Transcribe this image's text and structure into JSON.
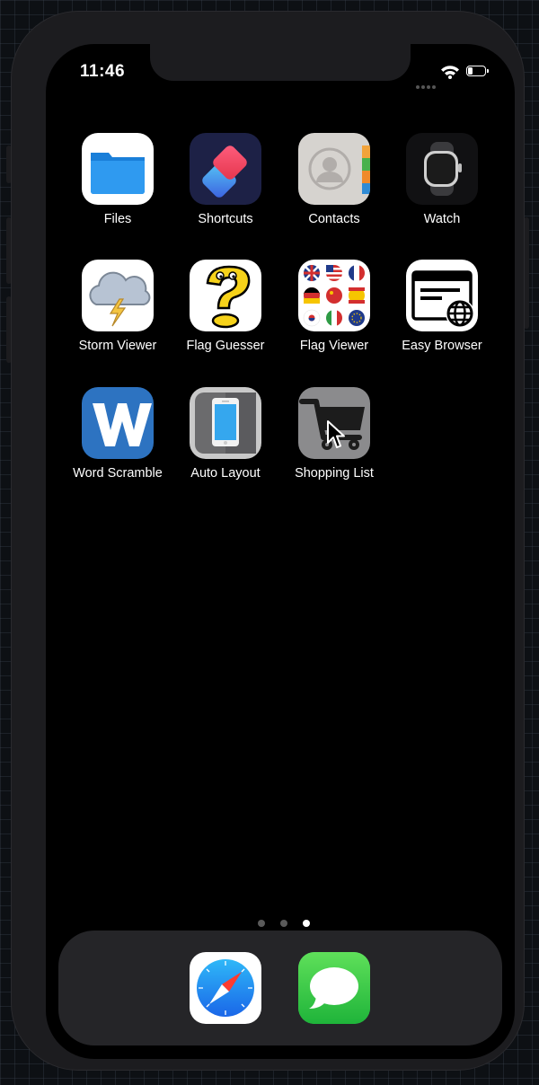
{
  "status_bar": {
    "time": "11:46",
    "battery_level": 0.3,
    "wifi_icon": "wifi-icon",
    "signal_icon": "cellular-signal-icon"
  },
  "home": {
    "apps": [
      {
        "label": "Files",
        "icon": "files-icon"
      },
      {
        "label": "Shortcuts",
        "icon": "shortcuts-icon"
      },
      {
        "label": "Contacts",
        "icon": "contacts-icon"
      },
      {
        "label": "Watch",
        "icon": "watch-icon"
      },
      {
        "label": "Storm Viewer",
        "icon": "storm-cloud-icon"
      },
      {
        "label": "Flag Guesser",
        "icon": "question-mark-icon"
      },
      {
        "label": "Flag Viewer",
        "icon": "flags-grid-icon"
      },
      {
        "label": "Easy Browser",
        "icon": "browser-globe-icon"
      },
      {
        "label": "Word Scramble",
        "icon": "letter-w-icon"
      },
      {
        "label": "Auto Layout",
        "icon": "phone-layout-icon"
      },
      {
        "label": "Shopping List",
        "icon": "shopping-cart-icon"
      }
    ]
  },
  "page_indicator": {
    "pages": 3,
    "current": 3
  },
  "dock": {
    "apps": [
      {
        "name": "Safari",
        "icon": "safari-compass-icon"
      },
      {
        "name": "Messages",
        "icon": "messages-bubble-icon"
      }
    ]
  },
  "colors": {
    "screen": "#000000",
    "frame": "#1c1c1f",
    "files_blue": "#1e88e5",
    "messages_green": "#34c759",
    "word_blue": "#2d73c1"
  }
}
